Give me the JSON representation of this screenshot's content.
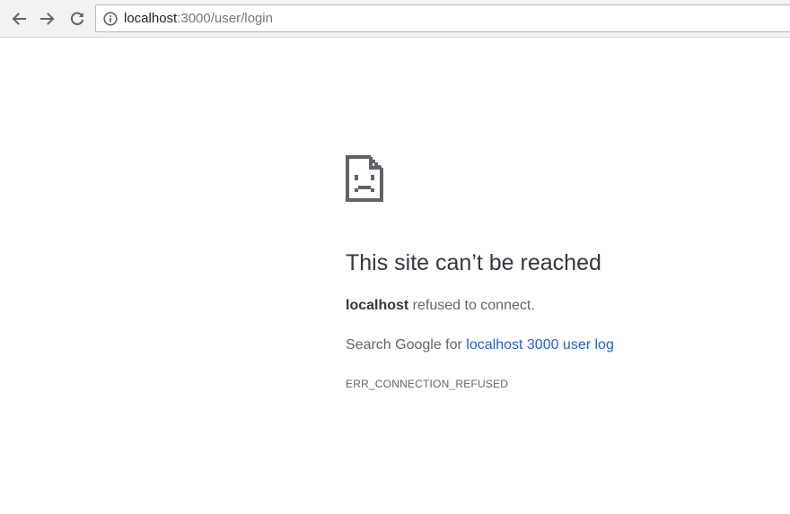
{
  "browser": {
    "url_host": "localhost",
    "url_rest": ":3000/user/login"
  },
  "icons": {
    "back": "arrow-left-icon",
    "forward": "arrow-right-icon",
    "reload": "reload-icon",
    "site_info": "info-icon",
    "error": "sad-page-icon"
  },
  "error_page": {
    "headline": "This site can’t be reached",
    "host": "localhost",
    "refused_text": " refused to connect.",
    "search_prefix": "Search Google for ",
    "search_link": "localhost 3000 user log",
    "error_code": "ERR_CONNECTION_REFUSED"
  },
  "colors": {
    "link": "#1e62d0",
    "headline": "#333740",
    "body_text": "#646464",
    "toolbar_bg": "#f2f2f2"
  }
}
